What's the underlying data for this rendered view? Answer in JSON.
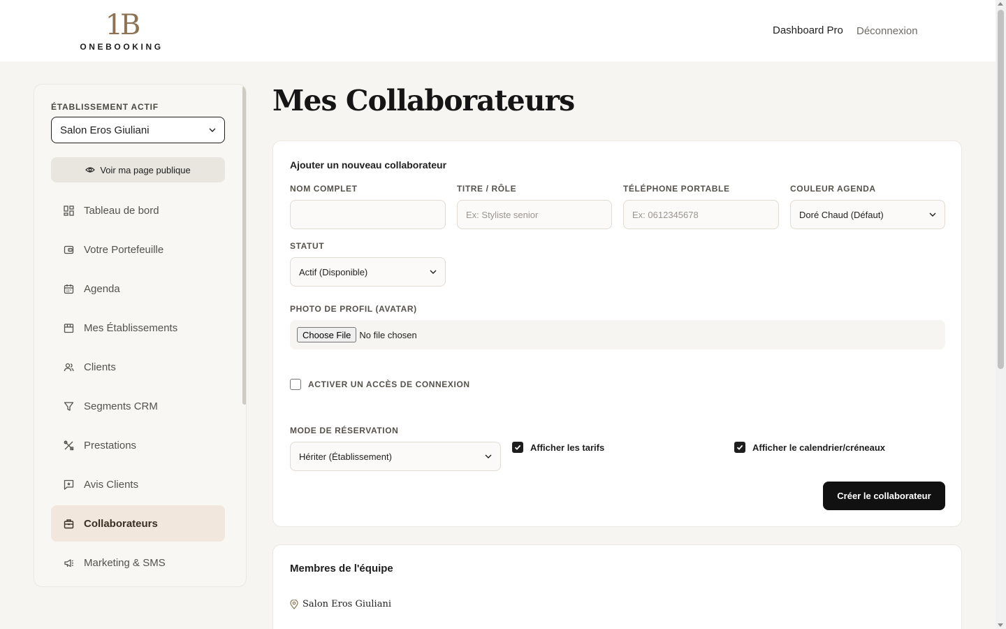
{
  "header": {
    "logo_mark": "1B",
    "logo_text": "ONEBOOKING",
    "nav_dashboard": "Dashboard Pro",
    "nav_logout": "Déconnexion"
  },
  "sidebar": {
    "establishment_label": "ÉTABLISSEMENT ACTIF",
    "establishment_value": "Salon Eros Giuliani",
    "public_page_label": "Voir ma page publique",
    "items": [
      {
        "label": "Tableau de bord",
        "icon": "dashboard-icon"
      },
      {
        "label": "Votre Portefeuille",
        "icon": "wallet-icon"
      },
      {
        "label": "Agenda",
        "icon": "calendar-icon"
      },
      {
        "label": "Mes Établissements",
        "icon": "store-icon"
      },
      {
        "label": "Clients",
        "icon": "users-icon"
      },
      {
        "label": "Segments CRM",
        "icon": "filter-icon"
      },
      {
        "label": "Prestations",
        "icon": "tools-icon"
      },
      {
        "label": "Avis Clients",
        "icon": "review-icon"
      },
      {
        "label": "Collaborateurs",
        "icon": "briefcase-icon",
        "active": true
      },
      {
        "label": "Marketing & SMS",
        "icon": "megaphone-icon"
      }
    ]
  },
  "main": {
    "title": "Mes Collaborateurs",
    "form": {
      "title": "Ajouter un nouveau collaborateur",
      "name_label": "NOM COMPLET",
      "name_value": "",
      "role_label": "TITRE / RÔLE",
      "role_placeholder": "Ex: Styliste senior",
      "phone_label": "TÉLÉPHONE PORTABLE",
      "phone_placeholder": "Ex: 0612345678",
      "color_label": "COULEUR AGENDA",
      "color_value": "Doré Chaud (Défaut)",
      "status_label": "STATUT",
      "status_value": "Actif (Disponible)",
      "photo_label": "PHOTO DE PROFIL (AVATAR)",
      "file_button": "Choose File",
      "file_status": "No file chosen",
      "login_access_label": "ACTIVER UN ACCÈS DE CONNEXION",
      "login_access_checked": false,
      "booking_mode_label": "MODE DE RÉSERVATION",
      "booking_mode_value": "Hériter (Établissement)",
      "show_prices_label": "Afficher les tarifs",
      "show_prices_checked": true,
      "show_calendar_label": "Afficher le calendrier/créneaux",
      "show_calendar_checked": true,
      "submit_label": "Créer le collaborateur"
    },
    "team": {
      "title": "Membres de l'équipe",
      "location": "Salon Eros Giuliani"
    }
  }
}
